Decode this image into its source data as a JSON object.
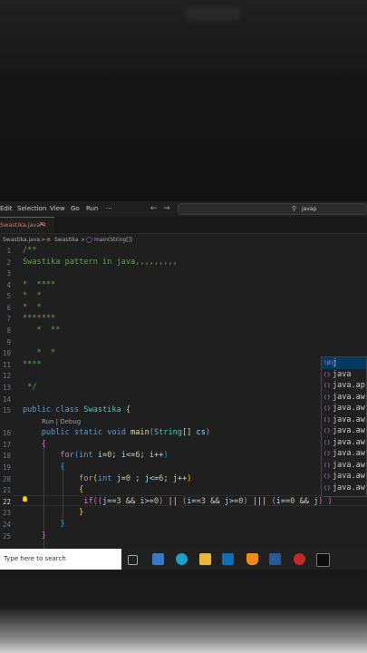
{
  "menubar": {
    "items": [
      "Edit",
      "Selection",
      "View",
      "Go",
      "Run",
      "···"
    ],
    "back_arrow": "←",
    "forward_arrow": "→",
    "command_center": "javap"
  },
  "tab": {
    "label": "Swastika.java 4",
    "close": "×"
  },
  "breadcrumb": {
    "file": "Swastika.java",
    "sep": ">",
    "class": "Swastika",
    "method": "main(String[])"
  },
  "line_numbers": [
    "1",
    "2",
    "3",
    "4",
    "5",
    "6",
    "7",
    "8",
    "9",
    "10",
    "11",
    "12",
    "13",
    "14",
    "15",
    "16",
    "17",
    "18",
    "19",
    "20",
    "21",
    "22",
    "23",
    "24",
    "25"
  ],
  "current_line": "22",
  "codelens": "Run | Debug",
  "code": {
    "l1": "/**",
    "l2": "Swastika pattern in java,,,,,,,,,",
    "l4": "*  ****",
    "l5": "*  *",
    "l6": "*  *",
    "l7": "*******",
    "l8": "   *  **",
    "l10": "   *  *",
    "l11": "****",
    "l13": " */",
    "public": "public",
    "class": "class",
    "classname": "Swastika",
    "static": "static",
    "void": "void",
    "main": "main",
    "string_type": "String",
    "args": "cs",
    "for": "for",
    "int": "int",
    "if": "if",
    "i": "i",
    "j": "j",
    "n0": "0",
    "n3": "3",
    "n6": "6"
  },
  "suggestions": [
    {
      "icon": "(Ø)",
      "text": "j",
      "selected": true
    },
    {
      "icon": "()",
      "text": "java"
    },
    {
      "icon": "()",
      "text": "java.ap"
    },
    {
      "icon": "()",
      "text": "java.aw"
    },
    {
      "icon": "()",
      "text": "java.aw"
    },
    {
      "icon": "()",
      "text": "java.aw"
    },
    {
      "icon": "()",
      "text": "java.aw"
    },
    {
      "icon": "()",
      "text": "java.aw"
    },
    {
      "icon": "()",
      "text": "java.aw"
    },
    {
      "icon": "()",
      "text": "java.aw"
    },
    {
      "icon": "()",
      "text": "java.aw"
    },
    {
      "icon": "()",
      "text": "java.aw"
    }
  ],
  "taskbar": {
    "search_placeholder": "Type here to search"
  },
  "colors": {
    "editor_bg": "#1f1f1f",
    "comment": "#6a9955",
    "keyword": "#569cd6",
    "type": "#4ec9b0",
    "accent": "#0078d4",
    "tab_modified": "#e0775b"
  }
}
